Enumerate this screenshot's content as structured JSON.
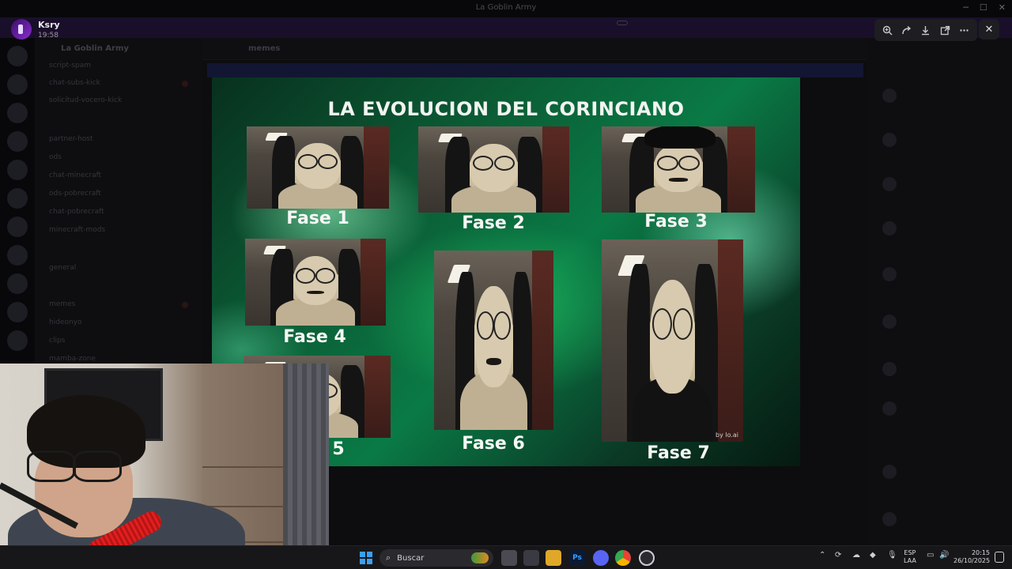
{
  "window": {
    "title": "La Goblin Army"
  },
  "banner": {
    "text": "",
    "button": ""
  },
  "overlay": {
    "user_name": "Ksry",
    "post_time": "19:58",
    "tools": [
      "zoom-icon",
      "forward-icon",
      "download-icon",
      "open-external-icon",
      "more-icon"
    ],
    "close_icon": "close-icon"
  },
  "server": {
    "name": "La Goblin Army",
    "channels": [
      "script-spam",
      "chat-subs-kick",
      "solicitud-vocero-kick",
      "partner-host",
      "ods",
      "chat-minecraft",
      "ods-pobrecraft",
      "chat-pobrecraft",
      "minecraft-mods",
      "general",
      "memes",
      "hideonyo",
      "clips",
      "mamba-zone"
    ],
    "active_channel": "memes"
  },
  "meme": {
    "title": "LA EVOLUCION DEL CORINCIANO",
    "watermark": "by lo.ai",
    "phases": [
      "Fase 1",
      "Fase 2",
      "Fase 3",
      "Fase 4",
      "5",
      "Fase 6",
      "Fase 7"
    ]
  },
  "taskbar": {
    "search_placeholder": "Buscar",
    "lang_top": "ESP",
    "lang_bottom": "LAA",
    "time": "20:15",
    "date": "26/10/2025",
    "apps": [
      "file-manager-icon",
      "task-view-icon",
      "explorer-icon",
      "photoshop-icon",
      "discord-icon",
      "chrome-icon",
      "app-icon"
    ],
    "photoshop_label": "Ps"
  },
  "colors": {
    "meme_green": "#0a7a45",
    "accent_purple": "#8a2cd0",
    "discord_blurple": "#5865f2"
  }
}
